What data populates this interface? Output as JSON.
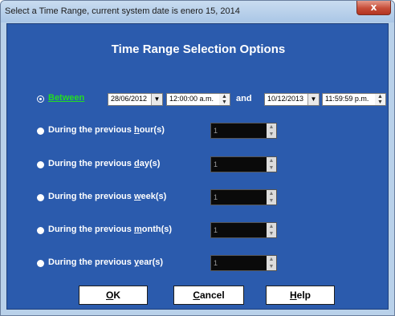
{
  "window": {
    "title": "Select a Time Range, current system date is enero 15, 2014",
    "close_glyph": "x"
  },
  "heading": "Time Range Selection Options",
  "between": {
    "label": "Between",
    "selected": true,
    "start_date": "28/06/2012",
    "start_time": "12:00:00 a.m.",
    "and_label": "and",
    "end_date": "10/12/2013",
    "end_time": "11:59:59 p.m."
  },
  "options": [
    {
      "prefix": "During the previous ",
      "key": "h",
      "suffix": "our(s)",
      "value": "1",
      "selected": false
    },
    {
      "prefix": "During the previous ",
      "key": "d",
      "suffix": "ay(s)",
      "value": "1",
      "selected": false
    },
    {
      "prefix": "During the previous ",
      "key": "w",
      "suffix": "eek(s)",
      "value": "1",
      "selected": false
    },
    {
      "prefix": "During the previous ",
      "key": "m",
      "suffix": "onth(s)",
      "value": "1",
      "selected": false
    },
    {
      "prefix": "During the previous ",
      "key": "y",
      "suffix": "ear(s)",
      "value": "1",
      "selected": false
    }
  ],
  "buttons": {
    "ok": {
      "key": "O",
      "rest": "K"
    },
    "cancel": {
      "key": "C",
      "rest": "ancel"
    },
    "help": {
      "key": "H",
      "rest": "elp"
    }
  },
  "icons": {
    "dropdown": "▼",
    "spin_up": "▲",
    "spin_down": "▼"
  },
  "colors": {
    "dialog_background": "#2b5bad",
    "selected_label": "#22dd22",
    "close_button": "#c64d38"
  }
}
